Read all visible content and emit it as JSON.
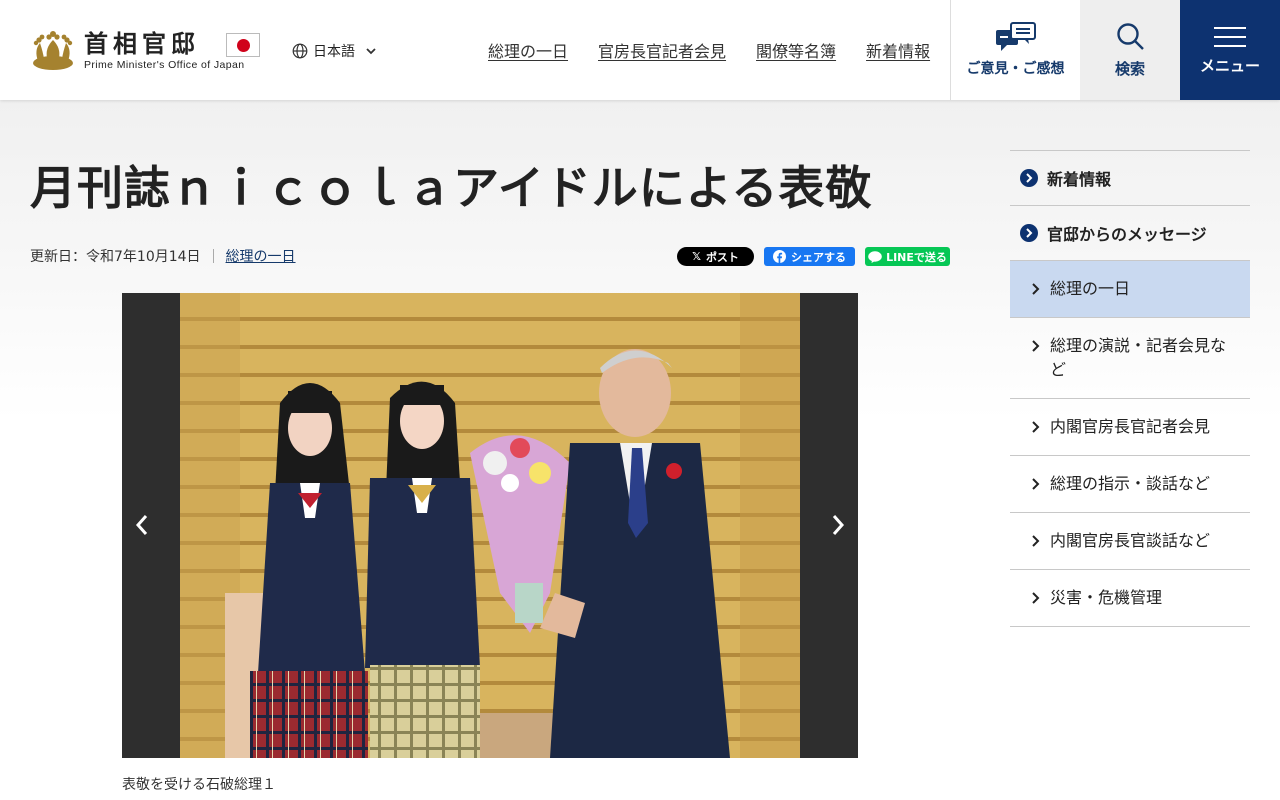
{
  "header": {
    "logo_title": "首相官邸",
    "logo_subtitle": "Prime Minister's Office of Japan",
    "language_label": "日本語",
    "nav": [
      {
        "label": "総理の一日"
      },
      {
        "label": "官房長官記者会見"
      },
      {
        "label": "閣僚等名簿"
      },
      {
        "label": "新着情報"
      }
    ],
    "opinion_label": "ご意見・ご感想",
    "search_label": "検索",
    "menu_label": "メニュー"
  },
  "article": {
    "title": "月刊誌ｎｉｃｏｌａアイドルによる表敬",
    "updated": "更新日：令和7年10月14日",
    "category_link": "総理の一日",
    "share": {
      "x": "ポスト",
      "facebook": "シェアする",
      "line": "LINEで送る"
    },
    "caption": "表敬を受ける石破総理１"
  },
  "sidebar": {
    "items": [
      {
        "label": "新着情報"
      },
      {
        "label": "官邸からのメッセージ"
      },
      {
        "label": "総理の一日"
      },
      {
        "label": "総理の演説・記者会見など"
      },
      {
        "label": "内閣官房長官記者会見"
      },
      {
        "label": "総理の指示・談話など"
      },
      {
        "label": "内閣官房長官談話など"
      },
      {
        "label": "災害・危機管理"
      }
    ]
  },
  "colors": {
    "brand_navy": "#0d3270",
    "active_bg": "#c9d9f0",
    "x_black": "#000000",
    "facebook_blue": "#1877f2",
    "line_green": "#06c755"
  }
}
